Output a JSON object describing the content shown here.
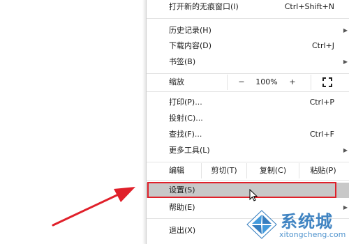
{
  "menu": {
    "incognito": {
      "label": "打开新的无痕窗口(I)",
      "shortcut": "Ctrl+Shift+N"
    },
    "history": {
      "label": "历史记录(H)"
    },
    "downloads": {
      "label": "下载内容(D)",
      "shortcut": "Ctrl+J"
    },
    "bookmarks": {
      "label": "书签(B)"
    },
    "zoom": {
      "label": "缩放",
      "minus": "−",
      "value": "100%",
      "plus": "+"
    },
    "print": {
      "label": "打印(P)...",
      "shortcut": "Ctrl+P"
    },
    "cast": {
      "label": "投射(C)..."
    },
    "find": {
      "label": "查找(F)...",
      "shortcut": "Ctrl+F"
    },
    "more_tools": {
      "label": "更多工具(L)"
    },
    "edit": {
      "label": "编辑",
      "cut": "剪切(T)",
      "copy": "复制(C)",
      "paste": "粘贴(P)"
    },
    "settings": {
      "label": "设置(S)"
    },
    "help": {
      "label": "帮助(E)"
    },
    "exit": {
      "label": "退出(X)"
    }
  },
  "watermark": {
    "title": "系统城",
    "url": "xitongcheng.com"
  },
  "colors": {
    "highlight": "#c8c8c8",
    "annotation": "#e0202a",
    "watermark": "#1f6fb8"
  }
}
